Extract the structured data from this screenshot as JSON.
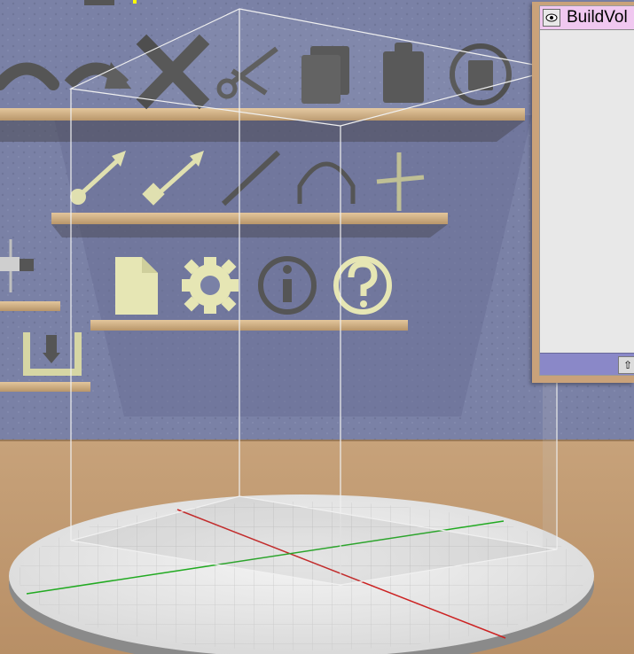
{
  "panel": {
    "title": "BuildVol",
    "scroll_up_glyph": "⇧"
  },
  "shelves": {
    "top_row_icons": [
      "undo-icon",
      "redo-icon",
      "delete-icon",
      "cut-icon",
      "copy-icon",
      "paste-icon",
      "paste-in-place-icon"
    ],
    "middle_row_icons": [
      "point-tool-icon",
      "square-tool-icon",
      "line-tool-icon",
      "arc-tool-icon",
      "axis-tool-icon"
    ],
    "bottom_row_icons": [
      "new-file-icon",
      "gear-icon",
      "info-icon",
      "help-icon"
    ],
    "left_row_icons": [
      "transform-icon",
      "import-icon"
    ]
  },
  "colors": {
    "wall": "#7a81a6",
    "floor": "#c9a47c",
    "shelf_wood": "#d2b48c",
    "icon_active": "#e6e6b4",
    "icon_inactive": "#555555",
    "panel_header": "#f0c8f0",
    "panel_footer": "#8a88c8",
    "axis_x": "#cc2222",
    "axis_y": "#22aa22"
  }
}
